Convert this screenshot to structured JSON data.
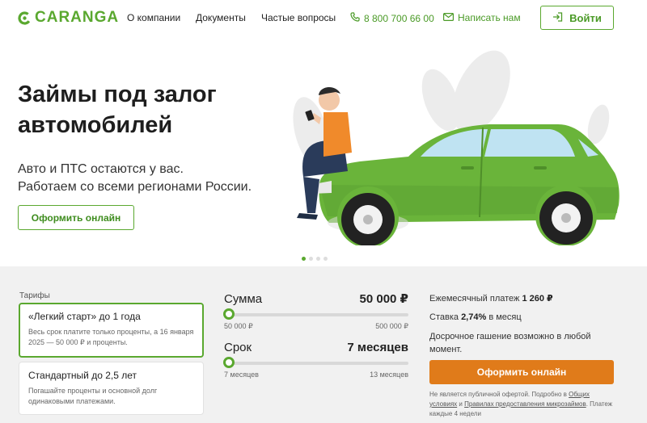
{
  "header": {
    "logo_text": "CARANGA",
    "nav": [
      "О компании",
      "Документы",
      "Частые вопросы"
    ],
    "phone": "8 800 700 66 00",
    "write_label": "Написать нам",
    "login_label": "Войти"
  },
  "hero": {
    "title": "Займы под залог автомобилей",
    "subtitle_line1": "Авто и ПТС остаются у вас.",
    "subtitle_line2": "Работаем со всеми регионами России.",
    "cta": "Оформить онлайн",
    "slides_total": 4,
    "slide_active": 1
  },
  "tariffs": {
    "label": "Тарифы",
    "items": [
      {
        "title": "«Легкий старт» до 1 года",
        "desc": "Весь срок платите только проценты, а 16 января 2025 — 50 000 ₽ и проценты.",
        "active": true
      },
      {
        "title": "Стандартный до 2,5 лет",
        "desc": "Погашайте проценты и основной долг одинаковыми платежами.",
        "active": false
      }
    ]
  },
  "calculator": {
    "sum": {
      "label": "Сумма",
      "value": "50 000 ₽",
      "min": "50 000 ₽",
      "max": "500 000 ₽",
      "position": 0
    },
    "term": {
      "label": "Срок",
      "value": "7 месяцев",
      "min": "7 месяцев",
      "max": "13 месяцев",
      "position": 0
    }
  },
  "summary": {
    "monthly_label": "Ежемесячный платеж",
    "monthly_value": "1 260 ₽",
    "rate_label": "Ставка",
    "rate_value": "2,74%",
    "rate_suffix": "в месяц",
    "early": "Досрочное гашение возможно в любой момент.",
    "apply": "Оформить онлайн",
    "disclaimer_1": "Не является публичной офертой. Подробно в",
    "disclaimer_link1": "Общих условиях",
    "disclaimer_2": "и",
    "disclaimer_link2": "Правилах предоставления микрозаймов",
    "disclaimer_3": ". Платеж каждые 4 недели"
  },
  "colors": {
    "brand": "#5aa82f",
    "accent_orange": "#e07b1a",
    "section_bg": "#f1f1f1"
  }
}
